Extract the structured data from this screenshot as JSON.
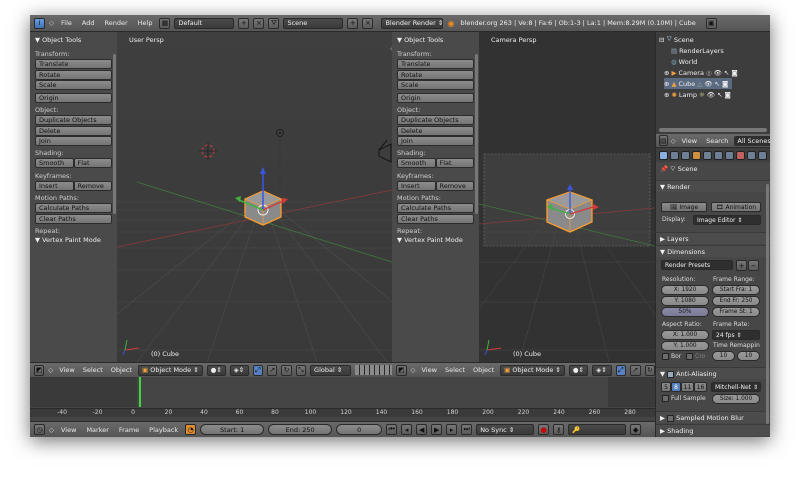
{
  "topbar": {
    "menus": [
      "File",
      "Add",
      "Render",
      "Help"
    ],
    "layout": "Default",
    "scene": "Scene",
    "engine": "Blender Render",
    "stats": "blender.org 263 | Ve:8 | Fa:6 | Ob:1-3 | La:1 | Mem:8.29M (0.10M) | Cube"
  },
  "tool_shelf": {
    "header": "▼ Object Tools",
    "transform_label": "Transform:",
    "translate": "Translate",
    "rotate": "Rotate",
    "scale": "Scale",
    "origin": "Origin",
    "object_label": "Object:",
    "duplicate": "Duplicate Objects",
    "delete": "Delete",
    "join": "Join",
    "shading_label": "Shading:",
    "smooth": "Smooth",
    "flat": "Flat",
    "keyframes_label": "Keyframes:",
    "insert": "Insert",
    "remove": "Remove",
    "motion_label": "Motion Paths:",
    "calc_paths": "Calculate Paths",
    "clear_paths": "Clear Paths",
    "repeat_label": "Repeat:",
    "vertex_paint": "▼ Vertex Paint Mode"
  },
  "viewport_left": {
    "title": "User Persp",
    "object": "(0) Cube"
  },
  "viewport_right": {
    "title": "Camera Persp",
    "object": "(0) Cube"
  },
  "view_header": {
    "view": "View",
    "select": "Select",
    "object": "Object",
    "mode": "Object Mode",
    "orientation": "Global"
  },
  "timeline": {
    "ticks": [
      "-40",
      "-20",
      "0",
      "20",
      "40",
      "60",
      "80",
      "100",
      "120",
      "140",
      "160",
      "180",
      "200",
      "220",
      "240",
      "260",
      "280"
    ],
    "current_frame_percent": 17.5
  },
  "bottom_bar": {
    "view": "View",
    "marker": "Marker",
    "frame": "Frame",
    "playback": "Playback",
    "start": "Start: 1",
    "end": "End: 250",
    "current": "0",
    "sync": "No Sync"
  },
  "outliner": {
    "scene": "Scene",
    "render_layers": "RenderLayers",
    "world": "World",
    "camera": "Camera",
    "cube": "Cube",
    "lamp": "Lamp"
  },
  "properties": {
    "view": "View",
    "search": "Search",
    "all_scenes": "All Scenes",
    "scene": "Scene",
    "render_header": "▼ Render",
    "image": "Image",
    "animation": "Animation",
    "display_label": "Display:",
    "display_value": "Image Editor",
    "layers": "▶ Layers",
    "dimensions": "▼ Dimensions",
    "render_presets": "Render Presets",
    "resolution_label": "Resolution:",
    "res_x": "X: 1920",
    "res_y": "Y: 1080",
    "res_pct": "50%",
    "frame_range_label": "Frame Range:",
    "start_fra": "Start Fra: 1",
    "end_fr": "End Fr: 250",
    "frame_st": "Frame St: 1",
    "aspect_label": "Aspect Ratio:",
    "asp_x": "X: 1.000",
    "asp_y": "Y: 1.000",
    "frame_rate_label": "Frame Rate:",
    "fps": "24 fps",
    "time_remap": "Time Remappin",
    "remap_a": "10",
    "remap_b": "10",
    "bor": "Bor",
    "cro": "Cro",
    "anti_aliasing": "Anti-Aliasing",
    "aa_5": "5",
    "aa_8": "8",
    "aa_11": "11",
    "aa_16": "16",
    "filter": "Mitchell-Net",
    "full_sample": "Full Sample",
    "size": "Size: 1.000",
    "motion_blur": "Sampled Motion Blur",
    "shading": "▶ Shading"
  },
  "colors": {
    "active_object": "#ff9c2c",
    "x_axis": "#d43a3a",
    "y_axis": "#3fb23f",
    "z_axis": "#3a55e0",
    "frame_cursor": "#3ed63e"
  }
}
